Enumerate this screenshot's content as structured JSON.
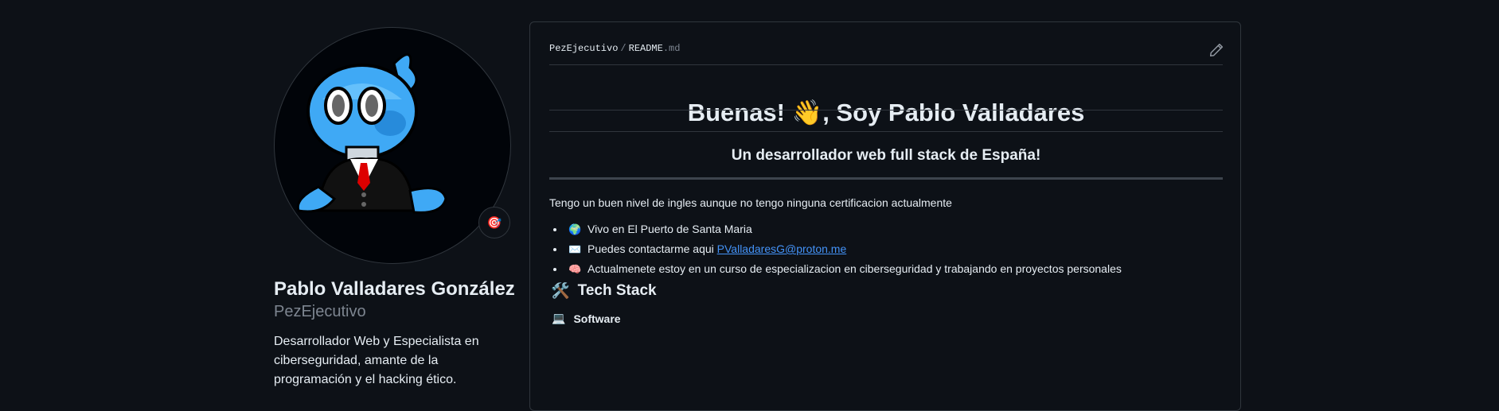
{
  "profile": {
    "name": "Pablo Valladares González",
    "username": "PezEjecutivo",
    "bio": "Desarrollador Web y Especialista en ciberseguridad, amante de la programación y el hacking ético.",
    "status_emoji": "🎯",
    "avatar_icon": "cartoon-fish-in-suit"
  },
  "readme": {
    "breadcrumb_owner": "PezEjecutivo",
    "breadcrumb_sep": "/",
    "breadcrumb_file": "README",
    "breadcrumb_ext": ".md",
    "edit_icon": "pencil-icon",
    "title": "Buenas! 👋, Soy Pablo Valladares",
    "subtitle": "Un desarrollador web full stack de España!",
    "intro": "Tengo un buen nivel de ingles aunque no tengo ninguna certificacion actualmente",
    "list": [
      {
        "emoji": "🌍",
        "text": "Vivo en El Puerto de Santa Maria"
      },
      {
        "emoji": "✉️",
        "text": "Puedes contactarme aqui ",
        "link": "PValladaresG@proton.me"
      },
      {
        "emoji": "🧠",
        "text": "Actualmenete estoy en un curso de especializacion en ciberseguridad y trabajando en proyectos personales"
      }
    ],
    "tech_stack_emoji": "🛠️",
    "tech_stack_heading": "Tech Stack",
    "software_emoji": "💻",
    "software_heading": "Software"
  },
  "colors": {
    "background": "#0d1117",
    "border": "#30363d",
    "text": "#e6edf3",
    "muted": "#7d8590",
    "link": "#4493f8"
  }
}
